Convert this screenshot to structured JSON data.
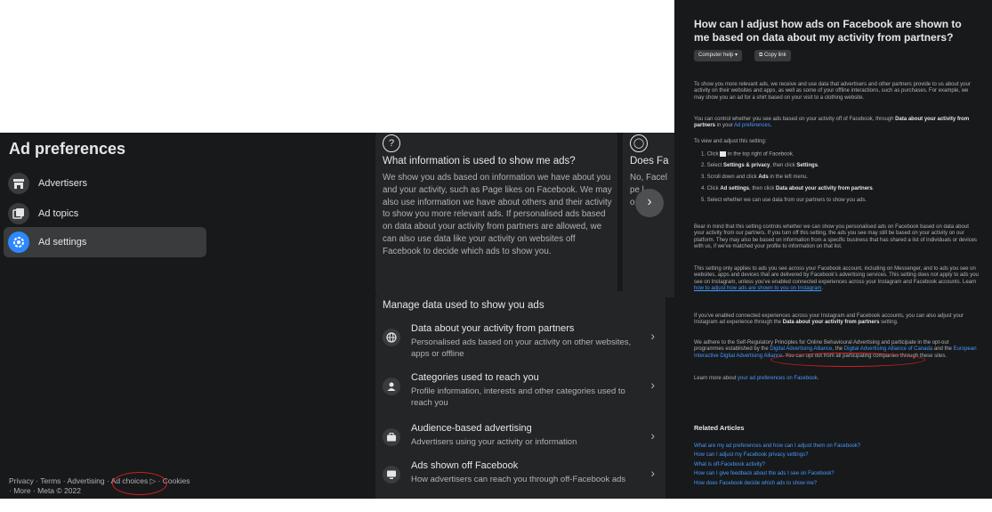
{
  "sidebar": {
    "title": "Ad preferences",
    "items": [
      {
        "label": "Advertisers",
        "icon": "storefront-icon"
      },
      {
        "label": "Ad topics",
        "icon": "ad-topics-icon"
      },
      {
        "label": "Ad settings",
        "icon": "gear-icon",
        "active": true
      }
    ],
    "footer": {
      "privacy": "Privacy",
      "terms": "Terms",
      "advertising": "Advertising",
      "ad_choices": "Ad choices",
      "cookies": "Cookies",
      "more": "More",
      "meta": "Meta © 2022"
    }
  },
  "cards": [
    {
      "title": "What information is used to show me ads?",
      "body": "We show you ads based on information we have about you and your activity, such as Page likes on Facebook. We may also use information we have about others and their activity to show you more relevant ads. If personalised ads based on data about your activity from partners are allowed, we can also use data like your activity on websites off Facebook to decide which ads to show you."
    },
    {
      "title": "Does Fa",
      "body": "No, Facel\npe l\no Fa"
    }
  ],
  "manage": {
    "title": "Manage data used to show you ads",
    "rows": [
      {
        "label": "Data about your activity from partners",
        "desc": "Personalised ads based on your activity on other websites, apps or offline",
        "icon": "globe-icon"
      },
      {
        "label": "Categories used to reach you",
        "desc": "Profile information, interests and other categories used to reach you",
        "icon": "person-icon"
      },
      {
        "label": "Audience-based advertising",
        "desc": "Advertisers using your activity or information",
        "icon": "briefcase-icon"
      },
      {
        "label": "Ads shown off Facebook",
        "desc": "How advertisers can reach you through off-Facebook ads",
        "icon": "monitor-icon"
      }
    ]
  },
  "help": {
    "title": "How can I adjust how ads on Facebook are shown to me based on data about my activity from partners?",
    "computer_help": "Computer help",
    "copy_link": "Copy link",
    "p1": "To show you more relevant ads, we receive and use data that advertisers and other partners provide to us about your activity on their websites and apps, as well as some of your offline interactions, such as purchases. For example, we may show you an ad for a shirt based on your visit to a clothing website.",
    "p2_a": "You can control whether you see ads based on your activity off of Facebook, through ",
    "p2_b": "Data about your activity from partners",
    "p2_c": " in your ",
    "p2_link": "Ad preferences",
    "p2_d": ".",
    "p3": "To view and adjust this setting:",
    "step1_a": "1. Click ",
    "step1_b": " in the top right of Facebook.",
    "step2_a": "2. Select ",
    "step2_b": "Settings & privacy",
    "step2_c": ", then click ",
    "step2_d": "Settings",
    "step2_e": ".",
    "step3_a": "3. Scroll down and click ",
    "step3_b": "Ads",
    "step3_c": " in the left menu.",
    "step4_a": "4. Click ",
    "step4_b": "Ad settings",
    "step4_c": ", then click ",
    "step4_d": "Data about your activity from partners",
    "step4_e": ".",
    "step5": "5. Select whether we can use data from our partners to show you ads.",
    "p4": "Bear in mind that this setting controls whether we can show you personalised ads on Facebook based on data about your activity from our partners. If you turn off this setting, the ads you see may still be based on your activity on our platform. They may also be based on information from a specific business that has shared a list of individuals or devices with us, if we've matched your profile to information on that list.",
    "p5_a": "This setting only applies to ads you see across your Facebook account, including on Messenger, and to ads you see on websites, apps and devices that are delivered by Facebook's advertising services. This setting does not apply to ads you see on Instagram, unless you've enabled connected experiences across your Instagram and Facebook accounts. Learn ",
    "p5_link": "how to adjust how ads are shown to you on Instagram",
    "p5_b": ".",
    "p6_a": "If you've enabled connected experiences across your Instagram and Facebook accounts, you can also adjust your Instagram ad experience through the ",
    "p6_b": "Data about your activity from partners",
    "p6_c": " setting.",
    "p7_a": "We adhere to the Self-Regulatory Principles for Online Behavioural Advertising and participate in the opt-out programmes established by the ",
    "p7_link1": "Digital Advertising Alliance",
    "p7_b": ", the ",
    "p7_link2": "Digital Advertising Alliance of Canada",
    "p7_c": " and the ",
    "p7_link3": "European Interactive Digital Advertising Alliance",
    "p7_d": ". You can opt out from all participating companies through these sites.",
    "p8_a": "Learn more about ",
    "p8_link": "your ad preferences on Facebook",
    "p8_b": ".",
    "related_title": "Related Articles",
    "related": [
      "What are my ad preferences and how can I adjust them on Facebook?",
      "How can I adjust my Facebook privacy settings?",
      "What is off-Facebook activity?",
      "How can I give feedback about the ads I see on Facebook?",
      "How does Facebook decide which ads to show me?"
    ]
  },
  "colors": {
    "accent": "#2d88ff",
    "link": "#4599ff",
    "annotation": "#d42020",
    "background": "#18191a",
    "card": "#242526"
  }
}
